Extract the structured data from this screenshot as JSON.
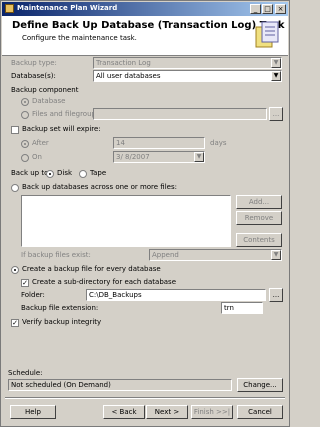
{
  "window": {
    "title": "Maintenance Plan Wizard",
    "controls": [
      "_",
      "□",
      "×"
    ]
  },
  "header": {
    "title": "Define Back Up Database (Transaction Log) Task",
    "subtitle": "Configure the maintenance task."
  },
  "form": {
    "backup_type_label": "Backup type:",
    "backup_type_value": "Transaction Log",
    "databases_label": "Database(s):",
    "databases_value": "All user databases",
    "backup_component_label": "Backup component",
    "component_database_label": "Database",
    "component_files_label": "Files and filegroups:",
    "expire_label": "Backup set will expire:",
    "after_label": "After",
    "after_value": "14",
    "days_label": "days",
    "on_label": "On",
    "on_value": "3/ 8/2007",
    "backup_to_label": "Back up to:",
    "disk_label": "Disk",
    "tape_label": "Tape",
    "across_files_label": "Back up databases across one or more files:",
    "add_label": "Add...",
    "remove_label": "Remove",
    "contents_label": "Contents",
    "if_exist_label": "If backup files exist:",
    "if_exist_value": "Append",
    "create_file_label": "Create a backup file for every database",
    "subdir_label": "Create a sub-directory for each database",
    "folder_label": "Folder:",
    "folder_value": "C:\\DB_Backups",
    "browse_label": "...",
    "extension_label": "Backup file extension:",
    "extension_value": "trn",
    "verify_label": "Verify backup integrity",
    "schedule_label": "Schedule:",
    "schedule_value": "Not scheduled (On Demand)",
    "change_label": "Change..."
  },
  "footer": {
    "help": "Help",
    "back": "< Back",
    "next": "Next >",
    "finish": "Finish >>|",
    "cancel": "Cancel"
  },
  "state": {
    "component_database_selected": true,
    "expire_checked": false,
    "after_selected": true,
    "disk_selected": true,
    "across_files_selected": false,
    "create_file_selected": true,
    "subdir_checked": true,
    "verify_checked": true
  }
}
